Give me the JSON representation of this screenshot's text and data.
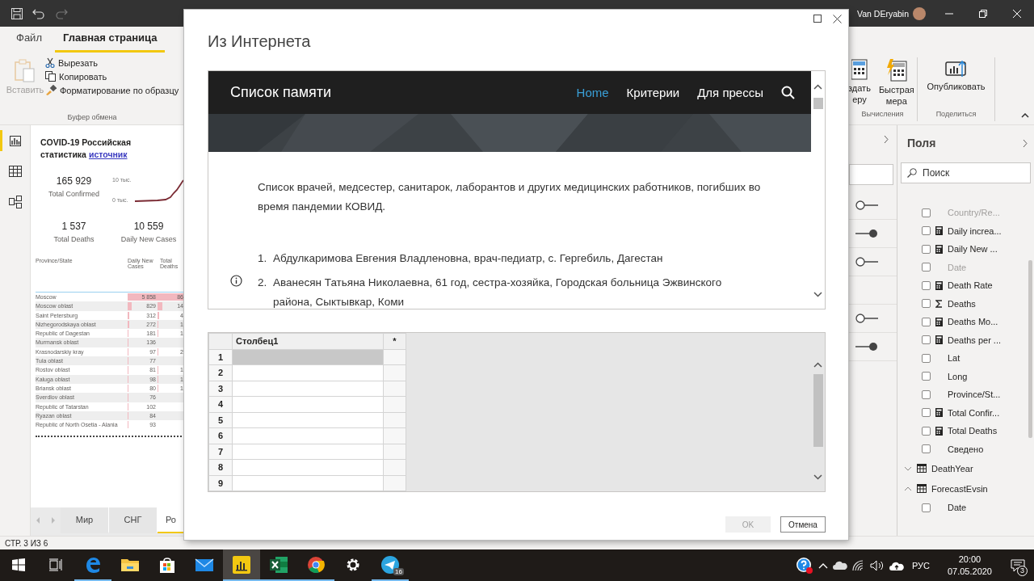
{
  "title_bar": {
    "user": "Van DEryabin"
  },
  "ribbon": {
    "tabs": [
      {
        "label": "Файл",
        "selected": false
      },
      {
        "label": "Главная страница",
        "selected": true
      }
    ],
    "clipboard": {
      "paste": "Вставить",
      "cut": "Вырезать",
      "copy": "Копировать",
      "format_painter": "Форматирование по образцу",
      "group": "Буфер обмена"
    },
    "calculations": {
      "new_measure": [
        "здать",
        "еру"
      ],
      "quick_measure": [
        "Быстрая",
        "мера"
      ],
      "group": "Вычисления"
    },
    "share": {
      "publish": "Опубликовать",
      "group": "Поделиться"
    }
  },
  "nav_rail": [
    {
      "kind": "report",
      "selected": true
    },
    {
      "kind": "data",
      "selected": false
    },
    {
      "kind": "model",
      "selected": false
    }
  ],
  "report": {
    "title": "COVID-19 Российская статистика",
    "link": "источник",
    "kpis": [
      {
        "value": "165 929",
        "label": "Total Confirmed"
      },
      {
        "value": "1 537",
        "label": "Total Deaths"
      },
      {
        "value": "10 559",
        "label": "Daily New Cases"
      }
    ],
    "sparkline_ticks": [
      "10 тыс.",
      "0 тыс."
    ],
    "table": {
      "columns": [
        "Province/State",
        "Daily New Cases",
        "Total Deaths"
      ],
      "rows": [
        {
          "name": "Moscow",
          "cases": "5 858",
          "deaths": "86"
        },
        {
          "name": "Moscow oblast",
          "cases": "829",
          "deaths": "14"
        },
        {
          "name": "Saint Petersburg",
          "cases": "312",
          "deaths": "4"
        },
        {
          "name": "Nizhegorodskaya oblast",
          "cases": "272",
          "deaths": "1"
        },
        {
          "name": "Republic of Dagestan",
          "cases": "181",
          "deaths": "1"
        },
        {
          "name": "Murmansk oblast",
          "cases": "136"
        },
        {
          "name": "Krasnodarskiy kray",
          "cases": "97",
          "deaths": "2"
        },
        {
          "name": "Tula oblast",
          "cases": "77"
        },
        {
          "name": "Rostov oblast",
          "cases": "81",
          "deaths": "1"
        },
        {
          "name": "Kaluga oblast",
          "cases": "98",
          "deaths": "1"
        },
        {
          "name": "Briansk oblast",
          "cases": "80",
          "deaths": "1"
        },
        {
          "name": "Sverdlov oblast",
          "cases": "76"
        },
        {
          "name": "Republic of Tatarstan",
          "cases": "102"
        },
        {
          "name": "Ryazan oblast",
          "cases": "84"
        },
        {
          "name": "Republic of North Osetia - Alania",
          "cases": "93"
        }
      ]
    }
  },
  "page_tabs": [
    {
      "label": "Мир",
      "selected": false
    },
    {
      "label": "СНГ",
      "selected": false
    },
    {
      "label": "Ро",
      "selected": true
    }
  ],
  "status_bar": "СТР. 3 ИЗ 6",
  "dialog": {
    "title": "Из Интернета",
    "web_page": {
      "site_title": "Список памяти",
      "nav": [
        {
          "label": "Home",
          "selected": true
        },
        {
          "label": "Критерии",
          "selected": false
        },
        {
          "label": "Для прессы",
          "selected": false
        }
      ],
      "intro": "Список врачей, медсестер, санитарок, лаборантов и других медицинских работников, погибших во время пандемии КОВИД.",
      "list": [
        {
          "marker": "1.",
          "text": "Абдулкаримова Евгения Владленовна, врач-педиатр, с. Гергебиль, Дагестан"
        },
        {
          "marker": "2.",
          "text": "Аванесян Татьяна Николаевна, 61 год, сестра-хозяйка, Городская больница Эжвинского района, Сыктывкар, Коми"
        }
      ]
    },
    "table": {
      "columns": [
        "Столбец1",
        "*"
      ],
      "rows": [
        {
          "number": "1",
          "selected": true
        },
        {
          "number": "2",
          "selected": false
        },
        {
          "number": "3",
          "selected": false
        },
        {
          "number": "4",
          "selected": false
        },
        {
          "number": "5",
          "selected": false
        },
        {
          "number": "6",
          "selected": false
        },
        {
          "number": "7",
          "selected": false
        },
        {
          "number": "8",
          "selected": false
        },
        {
          "number": "9",
          "selected": false
        }
      ]
    },
    "buttons": [
      {
        "label": "OK",
        "disabled": true
      },
      {
        "label": "Отмена",
        "disabled": false
      }
    ]
  },
  "visualizations": {
    "rows": [
      {
        "kind": "toggle",
        "on": false
      },
      {
        "kind": "toggle",
        "on": true
      },
      {
        "kind": "toggle",
        "on": false
      },
      {
        "kind": "blank"
      },
      {
        "kind": "toggle",
        "on": false
      },
      {
        "kind": "toggle",
        "on": true
      }
    ]
  },
  "fields": {
    "title": "Поля",
    "search": {
      "placeholder": "Поиск"
    },
    "items": [
      {
        "kind": "column",
        "name": "Country/Re...",
        "checked": false,
        "hidden": true
      },
      {
        "kind": "measure",
        "name": "Daily increa...",
        "checked": false,
        "hidden": false
      },
      {
        "kind": "measure",
        "name": "Daily New ...",
        "checked": false,
        "hidden": false
      },
      {
        "kind": "column",
        "name": "Date",
        "checked": false,
        "hidden": true
      },
      {
        "kind": "measure",
        "name": "Death Rate",
        "checked": false,
        "hidden": false
      },
      {
        "kind": "sum",
        "name": "Deaths",
        "checked": false,
        "hidden": false
      },
      {
        "kind": "measure",
        "name": "Deaths Mo...",
        "checked": false,
        "hidden": false
      },
      {
        "kind": "measure",
        "name": "Deaths per ...",
        "checked": false,
        "hidden": false
      },
      {
        "kind": "column",
        "name": "Lat",
        "checked": false,
        "hidden": false
      },
      {
        "kind": "column",
        "name": "Long",
        "checked": false,
        "hidden": false
      },
      {
        "kind": "column",
        "name": "Province/St...",
        "checked": false,
        "hidden": false
      },
      {
        "kind": "measure",
        "name": "Total Confir...",
        "checked": false,
        "hidden": false
      },
      {
        "kind": "measure",
        "name": "Total Deaths",
        "checked": false,
        "hidden": false
      },
      {
        "kind": "column",
        "name": "Сведено",
        "checked": false,
        "hidden": false
      },
      {
        "kind": "table",
        "name": "DeathYear",
        "expanded": false
      },
      {
        "kind": "table",
        "name": "ForecastEvsin",
        "expanded": true,
        "children": [
          {
            "kind": "column",
            "name": "Date",
            "checked": false,
            "hidden": false
          }
        ]
      }
    ]
  },
  "taskbar": {
    "apps": [
      {
        "kind": "edge",
        "running": true,
        "active": false
      },
      {
        "kind": "explorer",
        "running": false,
        "active": false
      },
      {
        "kind": "store",
        "running": false,
        "active": false
      },
      {
        "kind": "mail",
        "running": false,
        "active": false
      },
      {
        "kind": "powerbi",
        "running": true,
        "active": true
      },
      {
        "kind": "excel",
        "running": true,
        "active": false
      },
      {
        "kind": "chrome",
        "running": true,
        "active": false
      },
      {
        "kind": "settings",
        "running": false,
        "active": false
      },
      {
        "kind": "telegram",
        "running": true,
        "active": false,
        "badge": "16"
      }
    ],
    "tray": {
      "language": "РУС",
      "time": "20:00",
      "date": "07.05.2020",
      "notifications": "3"
    }
  }
}
